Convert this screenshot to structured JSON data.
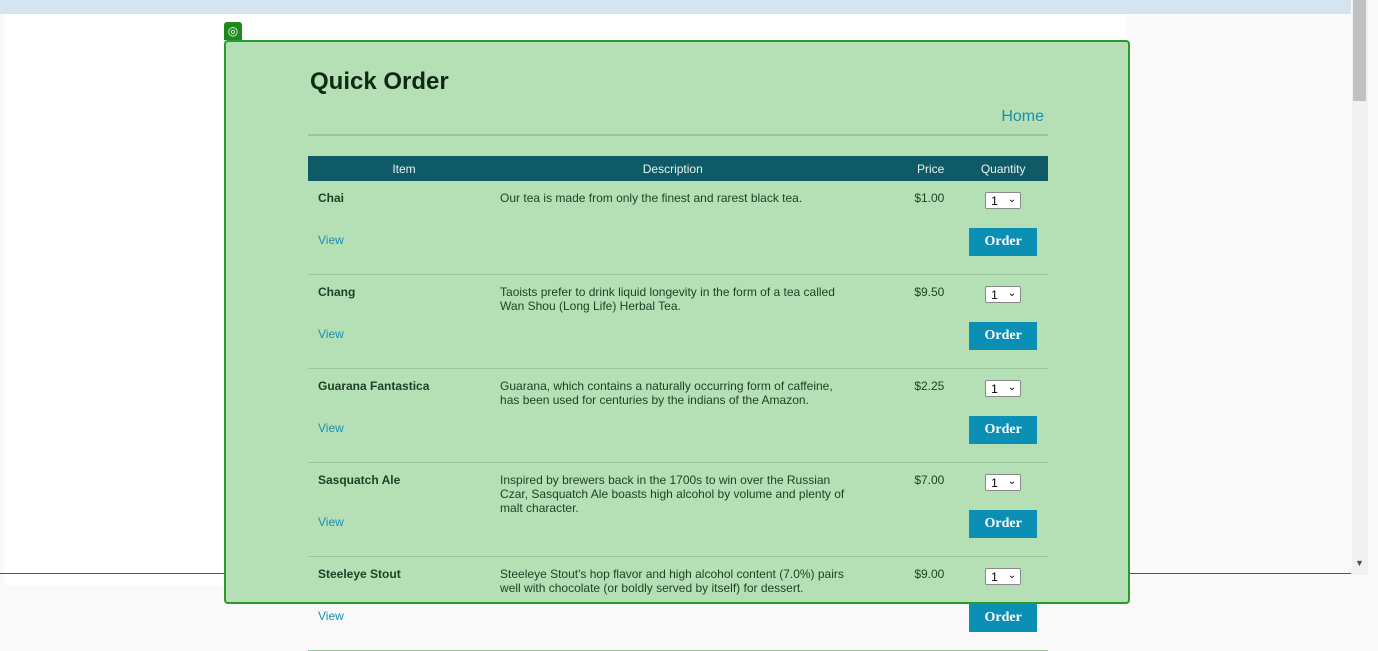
{
  "page": {
    "title": "Quick Order",
    "home_label": "Home"
  },
  "table": {
    "headers": {
      "item": "Item",
      "description": "Description",
      "price": "Price",
      "quantity": "Quantity"
    }
  },
  "products": [
    {
      "name": "Chai",
      "description": "Our tea is made from only the finest and rarest black tea.",
      "price": "$1.00",
      "quantity": "1",
      "view_label": "View",
      "order_label": "Order"
    },
    {
      "name": "Chang",
      "description": "Taoists prefer to drink liquid longevity in the form of a tea called Wan Shou (Long Life) Herbal Tea.",
      "price": "$9.50",
      "quantity": "1",
      "view_label": "View",
      "order_label": "Order"
    },
    {
      "name": "Guarana Fantastica",
      "description": "Guarana, which contains a naturally occurring form of caffeine, has been used for centuries by the indians of the Amazon.",
      "price": "$2.25",
      "quantity": "1",
      "view_label": "View",
      "order_label": "Order"
    },
    {
      "name": "Sasquatch Ale",
      "description": "Inspired by brewers back in the 1700s to win over the Russian Czar, Sasquatch Ale boasts high alcohol by volume and plenty of malt character.",
      "price": "$7.00",
      "quantity": "1",
      "view_label": "View",
      "order_label": "Order"
    },
    {
      "name": "Steeleye Stout",
      "description": "Steeleye Stout's hop flavor and high alcohol content (7.0%) pairs well with chocolate (or boldly served by itself) for dessert.",
      "price": "$9.00",
      "quantity": "1",
      "view_label": "View",
      "order_label": "Order"
    }
  ],
  "icons": {
    "webpart": "target-icon",
    "select_arrow": "chevron-down-icon",
    "scroll_down": "scroll-down-arrow-icon"
  },
  "colors": {
    "panel_bg": "#b5dfb5",
    "panel_border": "#2a9a2a",
    "header_bg": "#0e5a66",
    "button_bg": "#0b8fb5",
    "link": "#1b8fb0"
  }
}
